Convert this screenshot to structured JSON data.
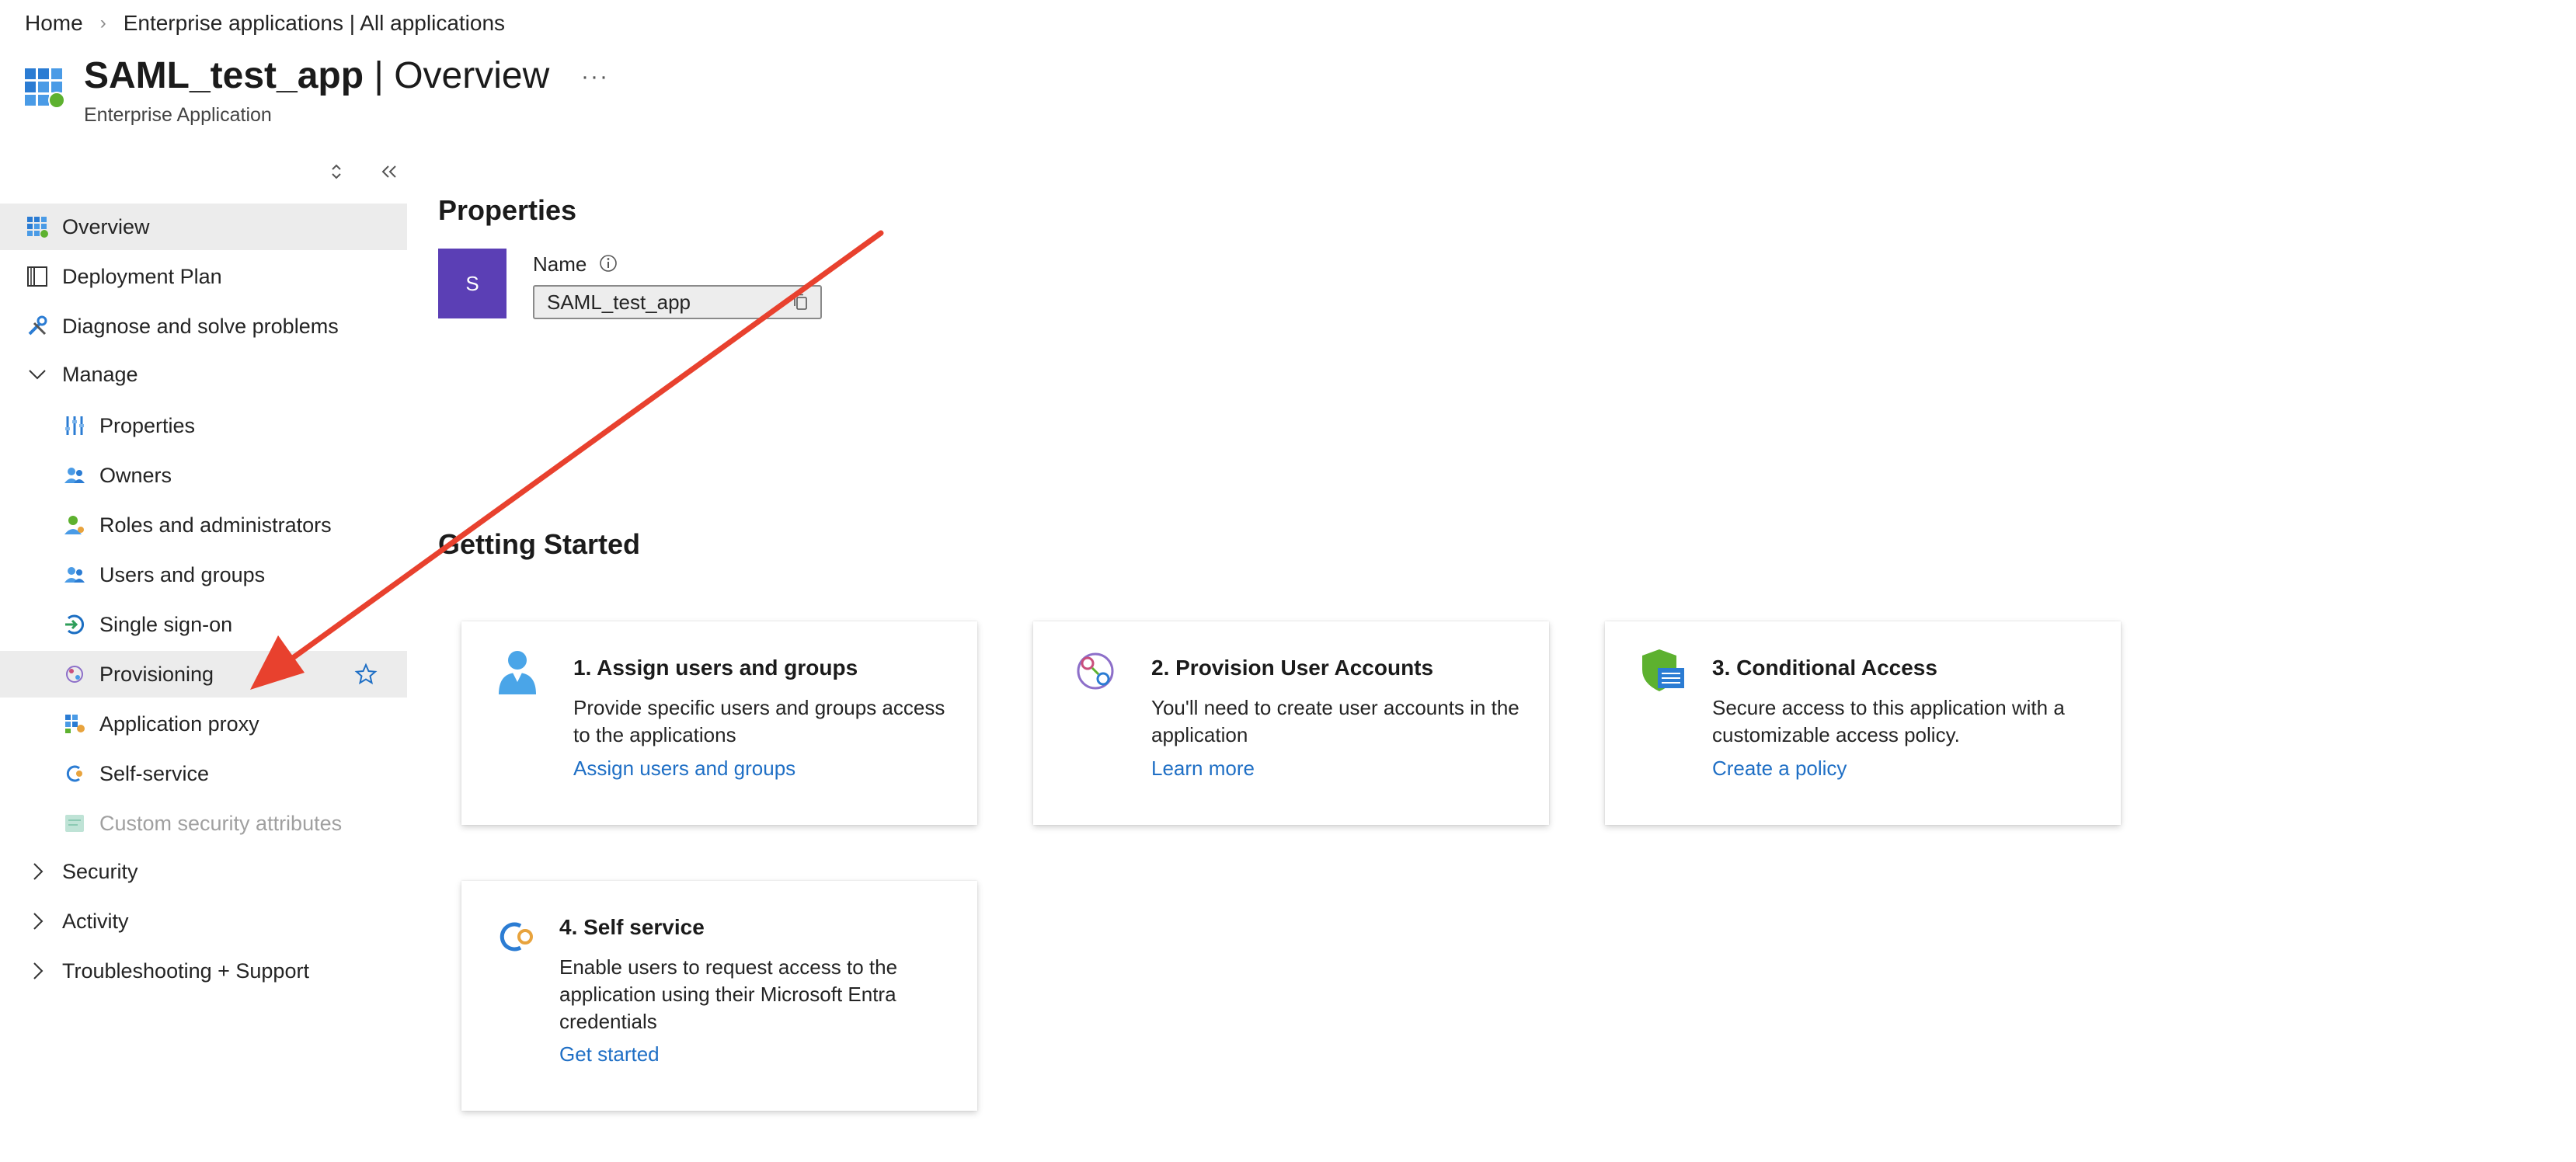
{
  "breadcrumb": {
    "home": "Home",
    "separator": "›",
    "current": "Enterprise applications | All applications"
  },
  "header": {
    "title_app": "SAML_test_app",
    "title_divider": " | ",
    "title_section": "Overview",
    "subtitle": "Enterprise Application",
    "more": "···"
  },
  "sidebar": {
    "items": [
      {
        "label": "Overview",
        "icon": "grid-icon"
      },
      {
        "label": "Deployment Plan",
        "icon": "book-icon"
      },
      {
        "label": "Diagnose and solve problems",
        "icon": "wrench-icon"
      },
      {
        "label": "Manage",
        "icon": "chevron-down-icon"
      },
      {
        "label": "Properties",
        "icon": "properties-icon"
      },
      {
        "label": "Owners",
        "icon": "owners-icon"
      },
      {
        "label": "Roles and administrators",
        "icon": "roles-icon"
      },
      {
        "label": "Users and groups",
        "icon": "users-icon"
      },
      {
        "label": "Single sign-on",
        "icon": "sso-icon"
      },
      {
        "label": "Provisioning",
        "icon": "provisioning-icon"
      },
      {
        "label": "Application proxy",
        "icon": "app-proxy-icon"
      },
      {
        "label": "Self-service",
        "icon": "self-service-icon"
      },
      {
        "label": "Custom security attributes",
        "icon": "custom-attributes-icon"
      },
      {
        "label": "Security",
        "icon": "chevron-right-icon"
      },
      {
        "label": "Activity",
        "icon": "chevron-right-icon"
      },
      {
        "label": "Troubleshooting + Support",
        "icon": "chevron-right-icon"
      }
    ]
  },
  "properties": {
    "heading": "Properties",
    "avatar_letter": "S",
    "name_label": "Name",
    "name_value": "SAML_test_app"
  },
  "getting_started": {
    "heading": "Getting Started",
    "cards": [
      {
        "title": "1. Assign users and groups",
        "desc": "Provide specific users and groups access to the applications",
        "link": "Assign users and groups"
      },
      {
        "title": "2. Provision User Accounts",
        "desc": "You'll need to create user accounts in the application",
        "link": "Learn more"
      },
      {
        "title": "3. Conditional Access",
        "desc": "Secure access to this application with a customizable access policy.",
        "link": "Create a policy"
      },
      {
        "title": "4. Self service",
        "desc": "Enable users to request access to the application using their Microsoft Entra credentials",
        "link": "Get started"
      }
    ]
  },
  "colors": {
    "accent": "#1f6fc5",
    "avatar": "#5b3fb5",
    "selected_bg": "#ececec",
    "annotation_arrow": "#e8412e"
  }
}
